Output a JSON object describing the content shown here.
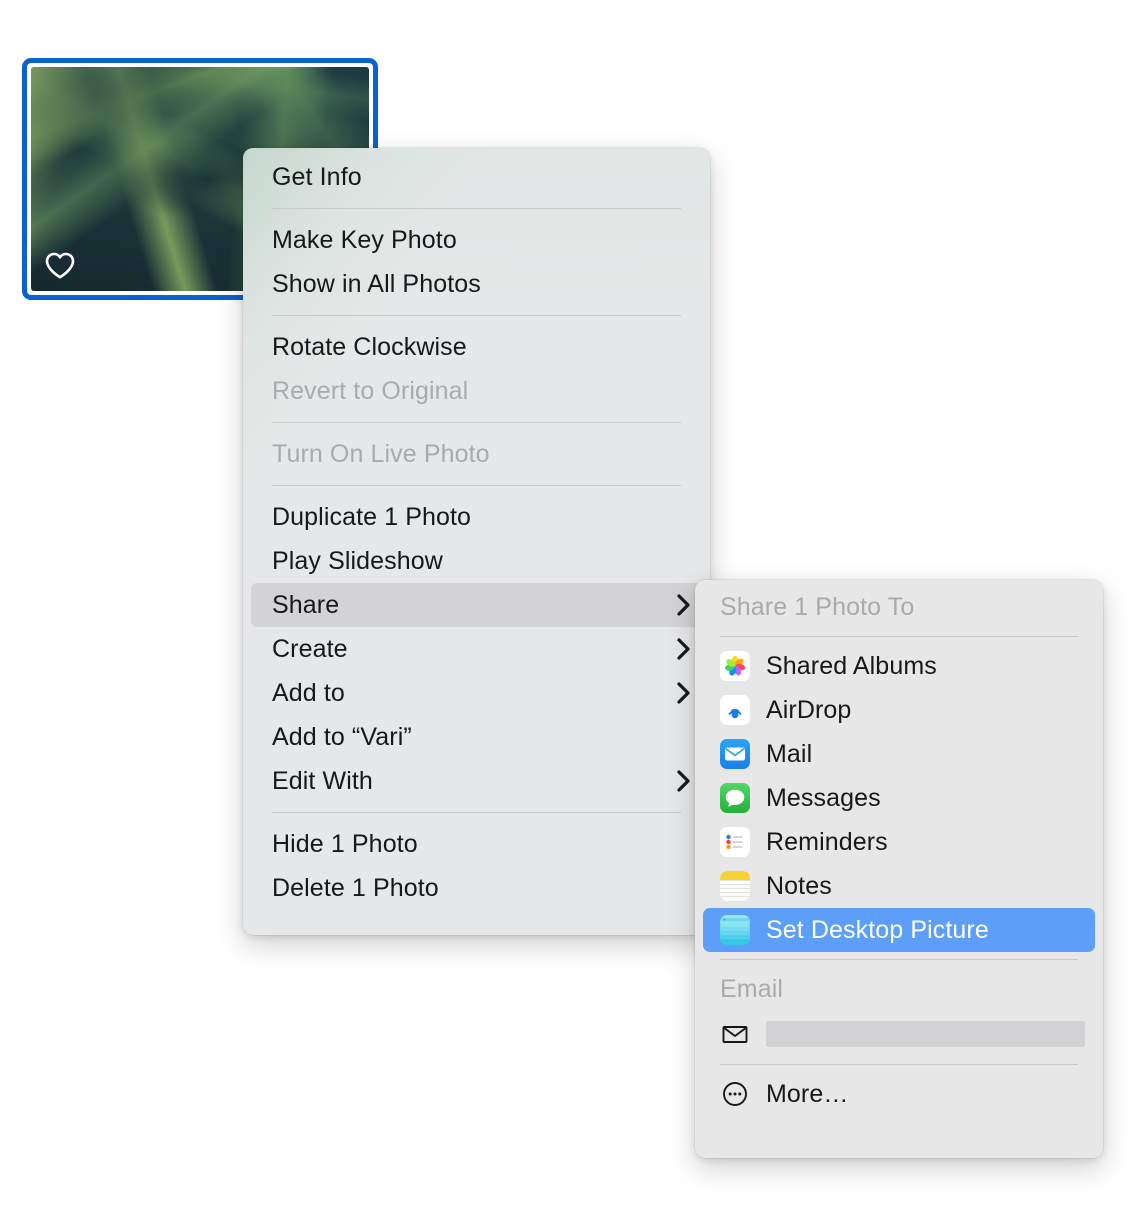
{
  "photo": {
    "name": "selected-photo-thumbnail",
    "favorite_icon": "heart-icon",
    "selected": "true"
  },
  "context_menu": {
    "groups": [
      {
        "items": [
          {
            "label": "Get Info",
            "disabled": false,
            "submenu": false,
            "highlighted": false
          }
        ]
      },
      {
        "items": [
          {
            "label": "Make Key Photo",
            "disabled": false,
            "submenu": false,
            "highlighted": false
          },
          {
            "label": "Show in All Photos",
            "disabled": false,
            "submenu": false,
            "highlighted": false
          }
        ]
      },
      {
        "items": [
          {
            "label": "Rotate Clockwise",
            "disabled": false,
            "submenu": false,
            "highlighted": false
          },
          {
            "label": "Revert to Original",
            "disabled": true,
            "submenu": false,
            "highlighted": false
          }
        ]
      },
      {
        "items": [
          {
            "label": "Turn On Live Photo",
            "disabled": true,
            "submenu": false,
            "highlighted": false
          }
        ]
      },
      {
        "items": [
          {
            "label": "Duplicate 1 Photo",
            "disabled": false,
            "submenu": false,
            "highlighted": false
          },
          {
            "label": "Play Slideshow",
            "disabled": false,
            "submenu": false,
            "highlighted": false
          },
          {
            "label": "Share",
            "disabled": false,
            "submenu": true,
            "highlighted": true
          },
          {
            "label": "Create",
            "disabled": false,
            "submenu": true,
            "highlighted": false
          },
          {
            "label": "Add to",
            "disabled": false,
            "submenu": true,
            "highlighted": false
          },
          {
            "label": "Add to “Vari”",
            "disabled": false,
            "submenu": false,
            "highlighted": false
          },
          {
            "label": "Edit With",
            "disabled": false,
            "submenu": true,
            "highlighted": false
          }
        ]
      },
      {
        "items": [
          {
            "label": "Hide 1 Photo",
            "disabled": false,
            "submenu": false,
            "highlighted": false
          },
          {
            "label": "Delete 1 Photo",
            "disabled": false,
            "submenu": false,
            "highlighted": false
          }
        ]
      }
    ]
  },
  "share_submenu": {
    "header": "Share 1 Photo To",
    "targets": [
      {
        "label": "Shared Albums",
        "icon": "photos-app-icon",
        "selected": false
      },
      {
        "label": "AirDrop",
        "icon": "airdrop-icon",
        "selected": false
      },
      {
        "label": "Mail",
        "icon": "mail-app-icon",
        "selected": false
      },
      {
        "label": "Messages",
        "icon": "messages-app-icon",
        "selected": false
      },
      {
        "label": "Reminders",
        "icon": "reminders-app-icon",
        "selected": false
      },
      {
        "label": "Notes",
        "icon": "notes-app-icon",
        "selected": false
      },
      {
        "label": "Set Desktop Picture",
        "icon": "desktop-picture-icon",
        "selected": true
      }
    ],
    "email_section_label": "Email",
    "email_address": "",
    "email_icon": "envelope-icon",
    "more_label": "More…",
    "more_icon": "ellipsis-circle-icon"
  },
  "colors": {
    "selection_border": "#0a62d0",
    "menu_background": "#e6e7e8",
    "highlight_blue": "#5d9ef8",
    "highlight_gray": "#d3d3d5",
    "disabled_text": "#a9aaad",
    "text": "#17181a",
    "separator": "#c9cacc"
  }
}
